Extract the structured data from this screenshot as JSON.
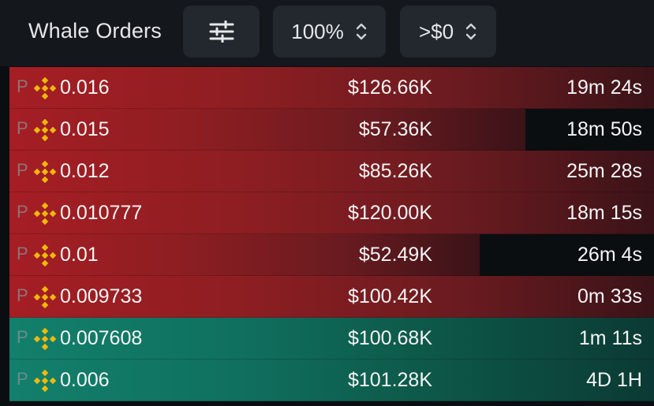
{
  "header": {
    "title": "Whale Orders",
    "filter_icon": "sliders-icon",
    "zoom_value": "100%",
    "min_value": ">$0"
  },
  "colors": {
    "ask": "#a51e24",
    "bid": "#12806c",
    "coin": "#f0b90b"
  },
  "rows": [
    {
      "type": "ask",
      "tag": "P",
      "price": "0.016",
      "amount": "$126.66K",
      "age": "19m 24s",
      "fill": 1.0
    },
    {
      "type": "ask",
      "tag": "P",
      "price": "0.015",
      "amount": "$57.36K",
      "age": "18m 50s",
      "fill": 0.8
    },
    {
      "type": "ask",
      "tag": "P",
      "price": "0.012",
      "amount": "$85.26K",
      "age": "25m 28s",
      "fill": 1.0
    },
    {
      "type": "ask",
      "tag": "P",
      "price": "0.010777",
      "amount": "$120.00K",
      "age": "18m 15s",
      "fill": 1.0
    },
    {
      "type": "ask",
      "tag": "P",
      "price": "0.01",
      "amount": "$52.49K",
      "age": "26m 4s",
      "fill": 0.73
    },
    {
      "type": "ask",
      "tag": "P",
      "price": "0.009733",
      "amount": "$100.42K",
      "age": "0m 33s",
      "fill": 1.0
    },
    {
      "type": "bid",
      "tag": "P",
      "price": "0.007608",
      "amount": "$100.68K",
      "age": "1m 11s",
      "fill": 1.0
    },
    {
      "type": "bid",
      "tag": "P",
      "price": "0.006",
      "amount": "$101.28K",
      "age": "4D 1H",
      "fill": 1.0
    }
  ]
}
